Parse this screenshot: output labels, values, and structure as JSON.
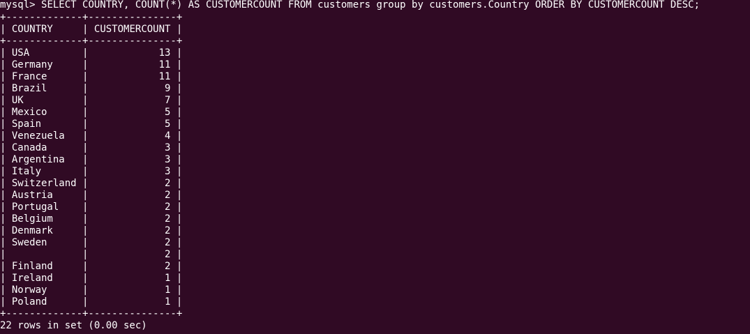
{
  "terminal": {
    "background": "#300a24",
    "foreground": "#ffffff",
    "prompt": "mysql> ",
    "command": "SELECT COUNTRY, COUNT(*) AS CUSTOMERCOUNT FROM customers group by customers.Country ORDER BY CUSTOMERCOUNT DESC;",
    "result": {
      "columns": [
        "COUNTRY",
        "CUSTOMERCOUNT"
      ],
      "rows": [
        [
          "USA",
          "13"
        ],
        [
          "Germany",
          "11"
        ],
        [
          "France",
          "11"
        ],
        [
          "Brazil",
          "9"
        ],
        [
          "UK",
          "7"
        ],
        [
          "Mexico",
          "5"
        ],
        [
          "Spain",
          "5"
        ],
        [
          "Venezuela",
          "4"
        ],
        [
          "Canada",
          "3"
        ],
        [
          "Argentina",
          "3"
        ],
        [
          "Italy",
          "3"
        ],
        [
          "Switzerland",
          "2"
        ],
        [
          "Austria",
          "2"
        ],
        [
          "Portugal",
          "2"
        ],
        [
          "Belgium",
          "2"
        ],
        [
          "Denmark",
          "2"
        ],
        [
          "Sweden",
          "2"
        ],
        [
          "",
          "2"
        ],
        [
          "Finland",
          "2"
        ],
        [
          "Ireland",
          "1"
        ],
        [
          "Norway",
          "1"
        ],
        [
          "Poland",
          "1"
        ]
      ]
    },
    "status": "22 rows in set (0.00 sec)"
  }
}
